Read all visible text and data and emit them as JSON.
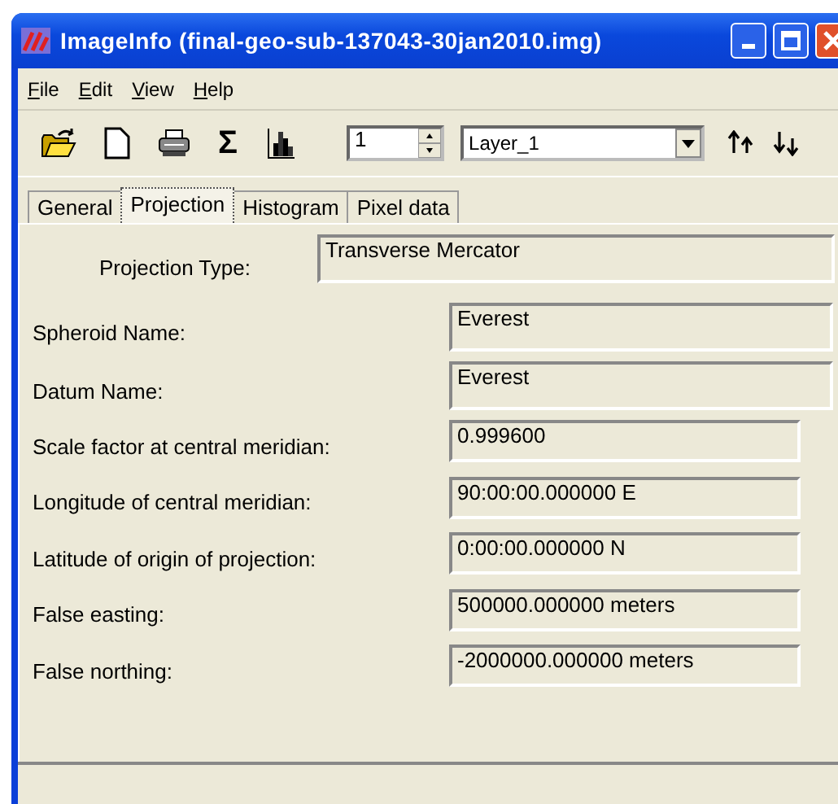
{
  "window": {
    "title": "ImageInfo (final-geo-sub-137043-30jan2010.img)"
  },
  "menu": [
    {
      "label": "File"
    },
    {
      "label": "Edit"
    },
    {
      "label": "View"
    },
    {
      "label": "Help"
    }
  ],
  "toolbar": {
    "sum_symbol": "Σ",
    "layer_number": "1",
    "layer": "Layer_1"
  },
  "tabs": [
    {
      "label": "General",
      "selected": false
    },
    {
      "label": "Projection",
      "selected": true
    },
    {
      "label": "Histogram",
      "selected": false
    },
    {
      "label": "Pixel data",
      "selected": false
    }
  ],
  "projection_type": {
    "label": "Projection Type:",
    "value": "Transverse Mercator"
  },
  "fields": [
    {
      "label": "Spheroid Name:",
      "value": "Everest",
      "kind": "tall"
    },
    {
      "label": "Datum Name:",
      "value": "Everest",
      "kind": "tall"
    },
    {
      "label": "Scale factor at central meridian:",
      "value": "0.999600",
      "kind": "short"
    },
    {
      "label": "Longitude of central meridian:",
      "value": "90:00:00.000000 E",
      "kind": "short"
    },
    {
      "label": "Latitude of origin of projection:",
      "value": "0:00:00.000000 N",
      "kind": "short"
    },
    {
      "label": "False easting:",
      "value": "500000.000000 meters",
      "kind": "short"
    },
    {
      "label": "False northing:",
      "value": "-2000000.000000 meters",
      "kind": "short"
    }
  ]
}
